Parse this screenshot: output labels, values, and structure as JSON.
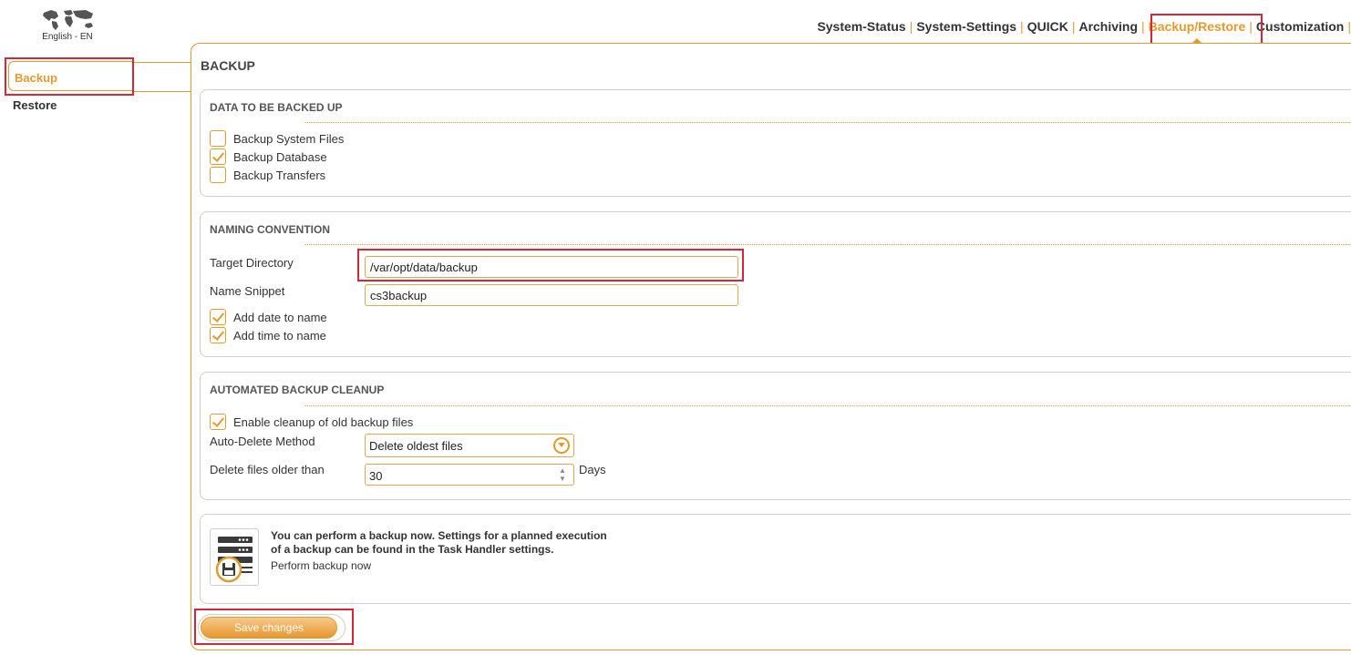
{
  "language": {
    "label": "English - EN"
  },
  "nav": {
    "items": [
      {
        "label": "System-Status",
        "active": false
      },
      {
        "label": "System-Settings",
        "active": false
      },
      {
        "label": "QUICK",
        "active": false
      },
      {
        "label": "Archiving",
        "active": false
      },
      {
        "label": "Backup/Restore",
        "active": true
      },
      {
        "label": "Customization",
        "active": false
      }
    ]
  },
  "sidebar": {
    "items": [
      {
        "label": "Backup",
        "active": true
      },
      {
        "label": "Restore",
        "active": false
      }
    ]
  },
  "page": {
    "title": "BACKUP"
  },
  "data_section": {
    "title": "DATA TO BE BACKED UP",
    "options": [
      {
        "label": "Backup System Files",
        "checked": false
      },
      {
        "label": "Backup Database",
        "checked": true
      },
      {
        "label": "Backup Transfers",
        "checked": false
      }
    ]
  },
  "naming": {
    "title": "NAMING CONVENTION",
    "target_directory_label": "Target Directory",
    "target_directory_value": "/var/opt/data/backup",
    "name_snippet_label": "Name Snippet",
    "name_snippet_value": "cs3backup",
    "add_date_label": "Add date to name",
    "add_date_checked": true,
    "add_time_label": "Add time to name",
    "add_time_checked": true
  },
  "cleanup": {
    "title": "AUTOMATED BACKUP CLEANUP",
    "enable_label": "Enable cleanup of old backup files",
    "enable_checked": true,
    "method_label": "Auto-Delete Method",
    "method_value": "Delete oldest files",
    "older_than_label": "Delete files older than",
    "older_than_value": "30",
    "older_than_unit": "Days"
  },
  "info": {
    "line1": "You can perform a backup now. Settings for a planned execution",
    "line2": "of a backup can be found in the Task Handler settings.",
    "perform_label": "Perform backup now"
  },
  "save": {
    "label": "Save changes"
  },
  "colors": {
    "accent": "#e39a2e",
    "highlight": "#d6263a",
    "text": "#333333"
  }
}
